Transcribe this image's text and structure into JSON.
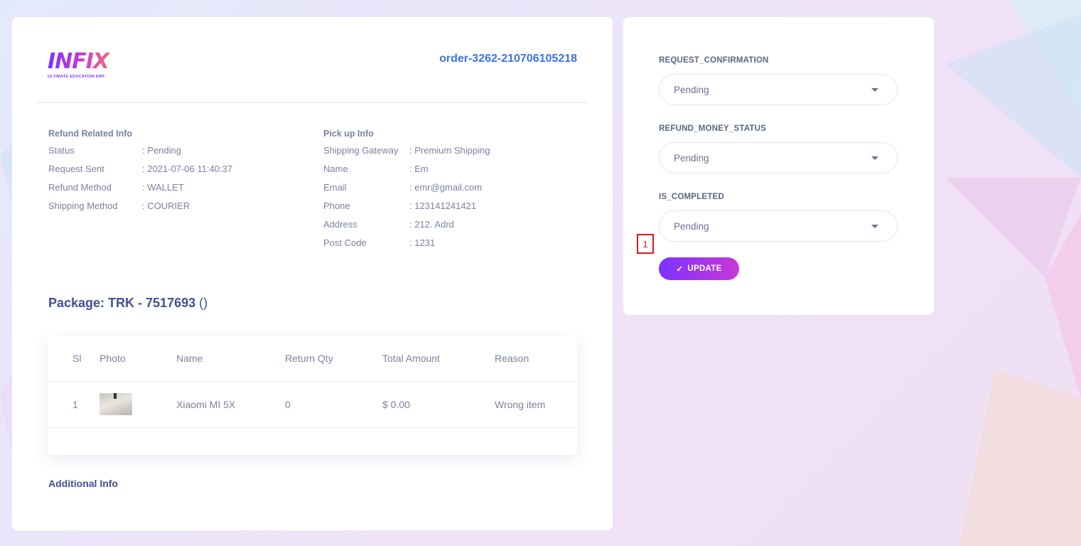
{
  "logo": {
    "text": "INFIX",
    "subtitle": "ULTIMATE EDUCATION ERP"
  },
  "order_id": "order-3262-210706105218",
  "refund_info": {
    "heading": "Refund Related Info",
    "rows": [
      {
        "label": "Status",
        "value": ": Pending"
      },
      {
        "label": "Request Sent",
        "value": ": 2021-07-06 11:40:37"
      },
      {
        "label": "Refund Method",
        "value": ": WALLET"
      },
      {
        "label": "Shipping Method",
        "value": ": COURIER"
      }
    ]
  },
  "pickup_info": {
    "heading": "Pick up Info",
    "rows": [
      {
        "label": "Shipping Gateway",
        "value": ": Premium Shipping"
      },
      {
        "label": "Name",
        "value": ": Em"
      },
      {
        "label": "Email",
        "value": ": emr@gmail.com"
      },
      {
        "label": "Phone",
        "value": ": 123141241421"
      },
      {
        "label": "Address",
        "value": ": 212. Adrd"
      },
      {
        "label": "Post Code",
        "value": ": 1231"
      }
    ]
  },
  "package": {
    "label": "Package: TRK - 7517693",
    "paren": "()"
  },
  "table": {
    "headers": [
      "Sl",
      "Photo",
      "Name",
      "Return Qty",
      "Total Amount",
      "Reason"
    ],
    "rows": [
      {
        "sl": "1",
        "name": "Xiaomi MI 5X",
        "qty": "0",
        "amount": "$ 0.00",
        "reason": "Wrong item"
      }
    ]
  },
  "additional_info": "Additional Info",
  "status_form": {
    "fields": [
      {
        "label": "REQUEST_CONFIRMATION",
        "value": "Pending"
      },
      {
        "label": "REFUND_MONEY_STATUS",
        "value": "Pending"
      },
      {
        "label": "IS_COMPLETED",
        "value": "Pending"
      }
    ],
    "update_label": "UPDATE"
  },
  "marker_label": "1",
  "colors": {
    "accent": "#7c32ff",
    "accent2": "#c738d8",
    "link": "#3b73e0",
    "heading": "#415094"
  }
}
